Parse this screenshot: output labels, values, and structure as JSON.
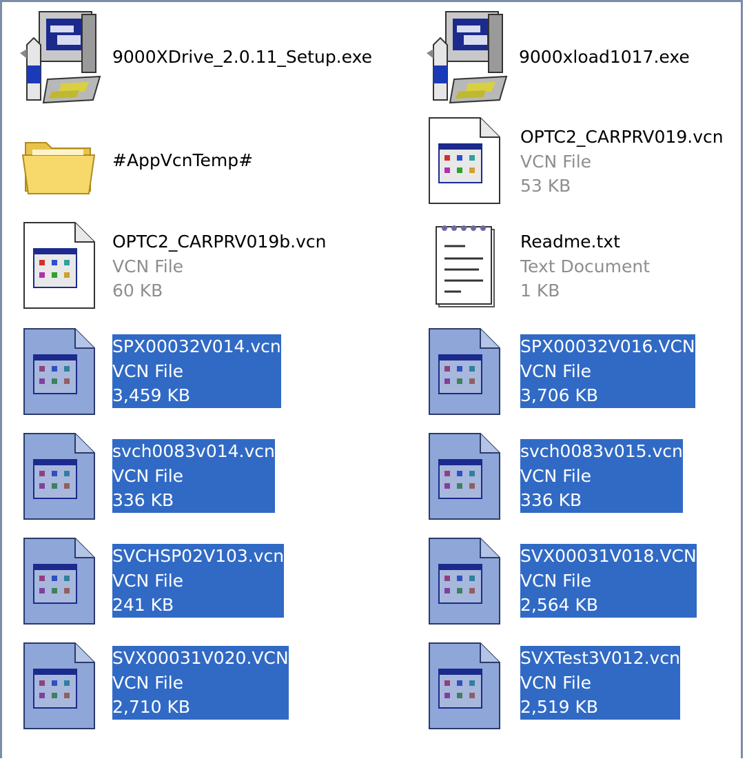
{
  "files": [
    {
      "name": "9000XDrive_2.0.11_Setup.exe",
      "icon": "installer-icon",
      "selected": false
    },
    {
      "name": "9000xload1017.exe",
      "icon": "installer-icon",
      "selected": false
    },
    {
      "name": "#AppVcnTemp#",
      "icon": "folder-icon",
      "selected": false
    },
    {
      "name": "OPTC2_CARPRV019.vcn",
      "type": "VCN File",
      "size": "53 KB",
      "icon": "vcn-file-icon",
      "selected": false
    },
    {
      "name": "OPTC2_CARPRV019b.vcn",
      "type": "VCN File",
      "size": "60 KB",
      "icon": "vcn-file-icon",
      "selected": false
    },
    {
      "name": "Readme.txt",
      "type": "Text Document",
      "size": "1 KB",
      "icon": "text-document-icon",
      "selected": false
    },
    {
      "name": "SPX00032V014.vcn",
      "type": "VCN File",
      "size": "3,459 KB",
      "icon": "vcn-file-icon",
      "selected": true
    },
    {
      "name": "SPX00032V016.VCN",
      "type": "VCN File",
      "size": "3,706 KB",
      "icon": "vcn-file-icon",
      "selected": true
    },
    {
      "name": "svch0083v014.vcn",
      "type": "VCN File",
      "size": "336 KB",
      "icon": "vcn-file-icon",
      "selected": true
    },
    {
      "name": "svch0083v015.vcn",
      "type": "VCN File",
      "size": "336 KB",
      "icon": "vcn-file-icon",
      "selected": true
    },
    {
      "name": "SVCHSP02V103.vcn",
      "type": "VCN File",
      "size": "241 KB",
      "icon": "vcn-file-icon",
      "selected": true
    },
    {
      "name": "SVX00031V018.VCN",
      "type": "VCN File",
      "size": "2,564 KB",
      "icon": "vcn-file-icon",
      "selected": true
    },
    {
      "name": "SVX00031V020.VCN",
      "type": "VCN File",
      "size": "2,710 KB",
      "icon": "vcn-file-icon",
      "selected": true
    },
    {
      "name": "SVXTest3V012.vcn",
      "type": "VCN File",
      "size": "2,519 KB",
      "icon": "vcn-file-icon",
      "selected": true
    }
  ],
  "colors": {
    "selection": "#316ac5",
    "selected_icon_tint": "#8ea6d8",
    "meta_text": "#8e8e8e",
    "frame_border": "#7a8ca8"
  }
}
